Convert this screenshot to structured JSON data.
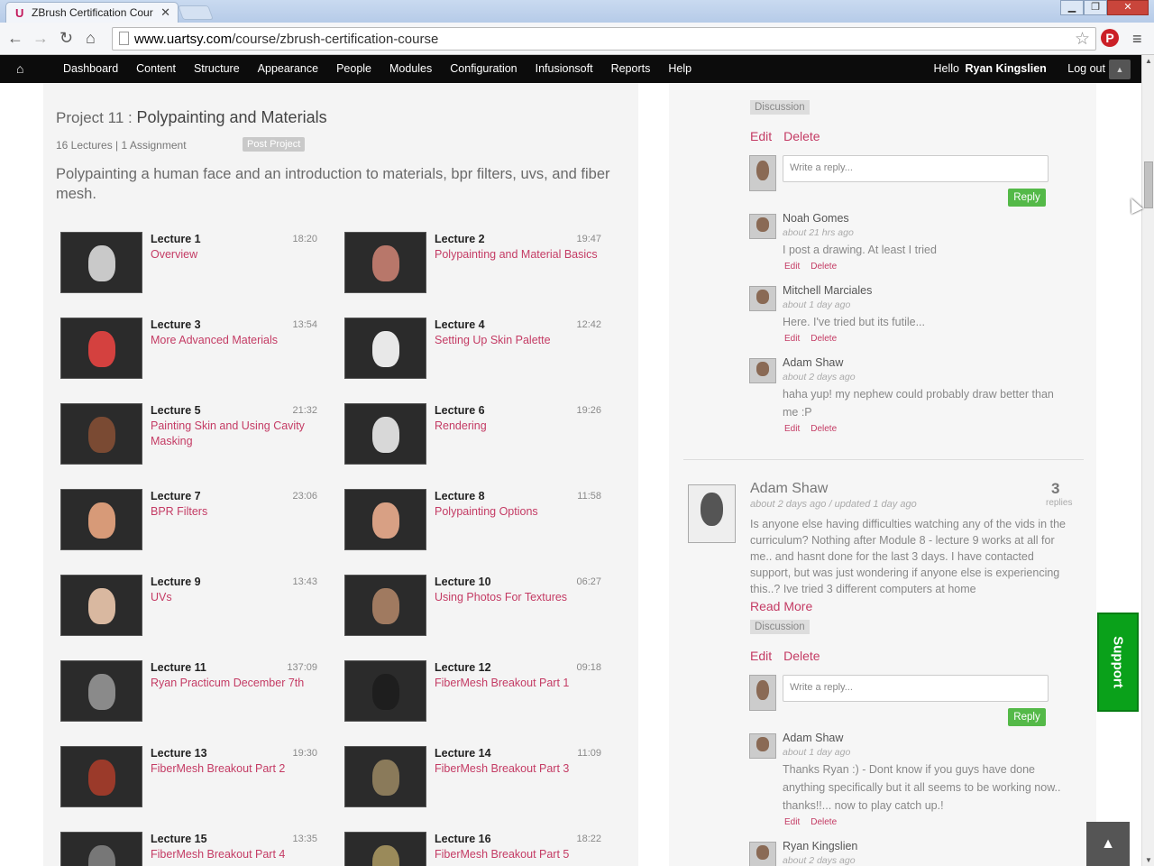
{
  "browser": {
    "tab_title": "ZBrush Certification Cour",
    "url_domain": "www.uartsy.com",
    "url_path": "/course/zbrush-certification-course"
  },
  "admin_bar": {
    "items": [
      "Dashboard",
      "Content",
      "Structure",
      "Appearance",
      "People",
      "Modules",
      "Configuration",
      "Infusionsoft",
      "Reports",
      "Help"
    ],
    "hello": "Hello",
    "user": "Ryan Kingslien",
    "logout": "Log out"
  },
  "project": {
    "prefix": "Project 11 : ",
    "title": "Polypainting and Materials",
    "meta": "16 Lectures | 1 Assignment",
    "post_button": "Post Project",
    "description": "Polypainting a human face and an introduction to materials, bpr filters, uvs, and fiber mesh."
  },
  "lectures": [
    {
      "num": "Lecture 1",
      "dur": "18:20",
      "name": "Overview",
      "tone": "#c9c9c9"
    },
    {
      "num": "Lecture 2",
      "dur": "19:47",
      "name": "Polypainting and Material Basics",
      "tone": "#b8776a"
    },
    {
      "num": "Lecture 3",
      "dur": "13:54",
      "name": "More Advanced Materials",
      "tone": "#d4413f"
    },
    {
      "num": "Lecture 4",
      "dur": "12:42",
      "name": "Setting Up Skin Palette",
      "tone": "#e8e8e8"
    },
    {
      "num": "Lecture 5",
      "dur": "21:32",
      "name": "Painting Skin and Using Cavity Masking",
      "tone": "#7a4a33"
    },
    {
      "num": "Lecture 6",
      "dur": "19:26",
      "name": "Rendering",
      "tone": "#d8d8d8"
    },
    {
      "num": "Lecture 7",
      "dur": "23:06",
      "name": "BPR Filters",
      "tone": "#d79a78"
    },
    {
      "num": "Lecture 8",
      "dur": "11:58",
      "name": "Polypainting Options",
      "tone": "#d8a084"
    },
    {
      "num": "Lecture 9",
      "dur": "13:43",
      "name": "UVs",
      "tone": "#d9b8a0"
    },
    {
      "num": "Lecture 10",
      "dur": "06:27",
      "name": "Using Photos For Textures",
      "tone": "#a07a60"
    },
    {
      "num": "Lecture 11",
      "dur": "137:09",
      "name": "Ryan Practicum December 7th",
      "tone": "#8a8a8a"
    },
    {
      "num": "Lecture 12",
      "dur": "09:18",
      "name": "FiberMesh Breakout Part 1",
      "tone": "#1e1e1e"
    },
    {
      "num": "Lecture 13",
      "dur": "19:30",
      "name": "FiberMesh Breakout Part 2",
      "tone": "#9b3a2a"
    },
    {
      "num": "Lecture 14",
      "dur": "11:09",
      "name": "FiberMesh Breakout Part 3",
      "tone": "#8a7a5a"
    },
    {
      "num": "Lecture 15",
      "dur": "13:35",
      "name": "FiberMesh Breakout Part 4",
      "tone": "#777"
    },
    {
      "num": "Lecture 16",
      "dur": "18:22",
      "name": "FiberMesh Breakout Part 5",
      "tone": "#9a8a5a"
    }
  ],
  "comments_top": {
    "tag": "Discussion",
    "edit": "Edit",
    "delete": "Delete",
    "reply_placeholder": "Write a reply...",
    "reply_button": "Reply",
    "replies": [
      {
        "name": "Noah Gomes",
        "time": "about 21 hrs ago",
        "text": "I post a drawing. At least I tried"
      },
      {
        "name": "Mitchell Marciales",
        "time": "about 1 day ago",
        "text": "Here. I've tried but its futile..."
      },
      {
        "name": "Adam Shaw",
        "time": "about 2 days ago",
        "text": "haha yup! my nephew could probably draw better than me :P"
      }
    ]
  },
  "post": {
    "author": "Adam Shaw",
    "time": "about 2 days ago / updated 1 day ago",
    "count": "3",
    "replies_label": "replies",
    "text": "Is anyone else having difficulties watching any of the vids in the curriculum? Nothing after Module 8 - lecture 9 works at all for me.. and hasnt done for the last 3 days. I have contacted support, but was just wondering if anyone else is experiencing this..? Ive tried 3 different computers at home",
    "read_more": "Read More",
    "tag": "Discussion",
    "edit": "Edit",
    "delete": "Delete",
    "reply_placeholder": "Write a reply...",
    "reply_button": "Reply",
    "replies": [
      {
        "name": "Adam Shaw",
        "time": "about 1 day ago",
        "text": "Thanks Ryan :) - Dont know if you guys have done anything specifically but it all seems to be working now.. thanks!!... now to play catch up.!"
      },
      {
        "name": "Ryan Kingslien",
        "time": "about 2 days ago",
        "text": ""
      }
    ]
  },
  "reply_edit": "Edit",
  "reply_delete": "Delete",
  "support_label": "Support",
  "to_top": "▲"
}
